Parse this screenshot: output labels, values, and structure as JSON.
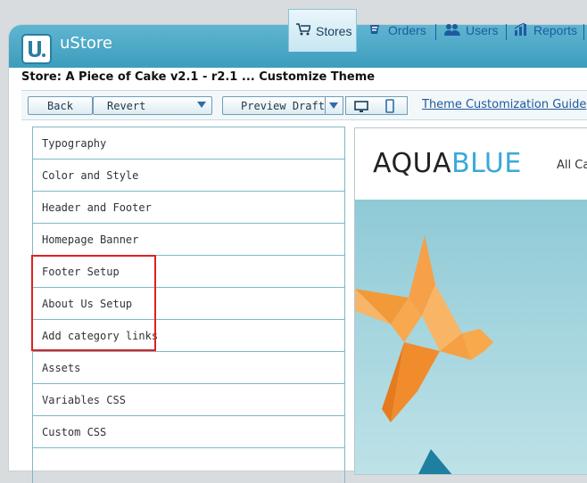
{
  "app": {
    "name": "uStore"
  },
  "nav": {
    "stores": "Stores",
    "orders": "Orders",
    "users": "Users",
    "reports": "Reports"
  },
  "breadcrumb": "Store: A Piece of Cake v2.1 - r2.1 ... Customize Theme",
  "toolbar": {
    "back": "Back",
    "revert": "Revert",
    "preview_draft": "Preview Draft",
    "guide_link": "Theme Customization Guide"
  },
  "menu": {
    "items": [
      "Typography",
      "Color and Style",
      "Header and Footer",
      "Homepage Banner",
      "Footer Setup",
      "About Us Setup",
      "Add category links",
      "Assets",
      "Variables CSS",
      "Custom CSS"
    ]
  },
  "preview": {
    "brand_part1": "AQUA",
    "brand_part2": "BLUE",
    "nav_text": "All Ca"
  },
  "colors": {
    "accent": "#39a9d8",
    "link": "#1f5a9e",
    "highlight": "#e02020"
  }
}
